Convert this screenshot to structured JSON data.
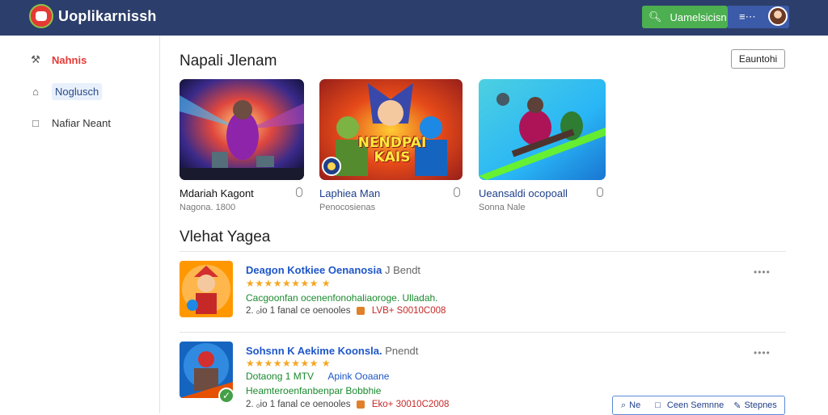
{
  "header": {
    "app_title": "Uoplikarnissh",
    "search_label": "Uamelsicisn",
    "menu_label": "≡⋯"
  },
  "sidebar": {
    "items": [
      {
        "label": "Nahnis",
        "icon": "wrench-icon"
      },
      {
        "label": "Noglusch",
        "icon": "home-icon"
      },
      {
        "label": "Nafiar Neant",
        "icon": "bookmark-icon"
      }
    ]
  },
  "main": {
    "section1_title": "Napali Jlenam",
    "top_button": "Eauntohi",
    "cards": [
      {
        "title": "Mdariah Kagont",
        "meta": "Nagona. 1800"
      },
      {
        "title": "Laphiea Man",
        "meta": "Penocosienas"
      },
      {
        "title": "Ueansaldi ocopoall",
        "meta": "Sonna Nale"
      }
    ],
    "card_banner": "NENDPAI KAIS",
    "section2_title": "Vlehat Yagea",
    "list": [
      {
        "title": "Deagon Kotkiee Oenanosia",
        "title_sub": "J Bendt",
        "stars": "★★★★★★★★ ★",
        "desc": "Cacgoonfan ocenenfonohaliaoroge. Ulladah.",
        "meta": "2. ₀io 1 fanal ce oenooles",
        "price": "LVB+ S0010C008"
      },
      {
        "title": "Sohsnn K Aekime Koonsla.",
        "title_sub": "Pnendt",
        "stars": "★★★★★★★★ ★",
        "desc_pre": "Dotaong 1 MTV",
        "desc_extra": "Apink  Ooaane",
        "desc": "Heamteroenfanbenpar Bobbhie",
        "meta": "2. ₀io 1 fanal ce oenooles",
        "price": "Eko+ 30010C2008"
      }
    ],
    "actions": [
      "Ne",
      "Ceen Semnne",
      "Stepnes"
    ]
  }
}
